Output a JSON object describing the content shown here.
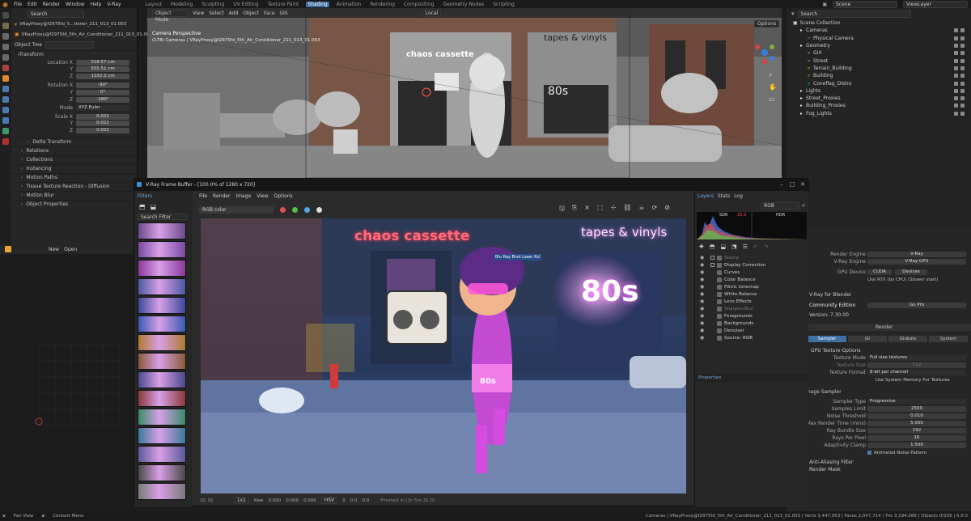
{
  "topbar": {
    "menus": [
      "File",
      "Edit",
      "Render",
      "Window",
      "Help",
      "V-Ray"
    ],
    "workspaces": [
      "Layout",
      "Modeling",
      "Sculpting",
      "UV Editing",
      "Texture Paint",
      "Shading",
      "Animation",
      "Rendering",
      "Compositing",
      "Geometry Nodes",
      "Scripting"
    ],
    "active_workspace": "Shading",
    "scene": "Scene",
    "view_layer": "ViewLayer",
    "search_placeholder": "Search"
  },
  "left_panel": {
    "breadcrumb1": "VRayProxy@f2975fd_5...tioner_211_013_01.003",
    "breadcrumb2": "VRayProxy@f2975fd_5th_Air_Conditioner_211_013_01.003",
    "object_tree_label": "Object Tree",
    "transform_header": "Transform",
    "location_label": "Location X",
    "location": [
      "218.57 cm",
      "555.51 cm",
      "1332.2 cm"
    ],
    "rotation_label": "Rotation X",
    "rotation": [
      "-90°",
      "0°",
      "-180°"
    ],
    "mode_label": "Mode",
    "mode_value": "XYZ Euler",
    "scale_label": "Scale X",
    "scale": [
      "0.022",
      "0.022",
      "0.022"
    ],
    "axis_y": "Y",
    "axis_z": "Z",
    "sections": [
      "Delta Transform",
      "Relations",
      "Collections",
      "Instancing",
      "Motion Paths",
      "Tissue Texture Reaction - Diffusion",
      "Motion Blur",
      "Object Properties"
    ],
    "new_label": "New",
    "open_label": "Open"
  },
  "viewport": {
    "mode": "Object Mode",
    "menus": [
      "View",
      "Select",
      "Add",
      "Object",
      "Face",
      "GIS"
    ],
    "transform_orientation": "Local",
    "camera_label": "Camera Perspective",
    "camera_path": "(178) Cameras | VRayProxy@f2975fd_5th_Air_Conditioner_211_013_01.003",
    "options": "Options",
    "signs": [
      "chaos cassette",
      "tapes & vinyls"
    ],
    "window_text": "80s"
  },
  "outliner": {
    "title": "Scene Collection",
    "items": [
      {
        "label": "Cameras",
        "indent": 1
      },
      {
        "label": "Physical Camera",
        "indent": 2
      },
      {
        "label": "Geometry",
        "indent": 1
      },
      {
        "label": "Girl",
        "indent": 2
      },
      {
        "label": "Street",
        "indent": 2
      },
      {
        "label": "Terrain_Building",
        "indent": 2
      },
      {
        "label": "Building",
        "indent": 2
      },
      {
        "label": "Coneflag_Distro",
        "indent": 2
      },
      {
        "label": "Lights",
        "indent": 1
      },
      {
        "label": "Street_Proxies",
        "indent": 1
      },
      {
        "label": "Building_Proxies",
        "indent": 1
      },
      {
        "label": "Fog_Lights",
        "indent": 1
      }
    ]
  },
  "render_props": {
    "engine_label": "Render Engine",
    "engine_value": "V-Ray",
    "vray_engine_label": "V-Ray Engine",
    "vray_engine_value": "V-Ray GPU",
    "gpu_device_label": "GPU Device",
    "cuda": "CUDA",
    "devices": "Devices",
    "rtx_note": "Use RTX (by CPU) (Slower start)",
    "vray_for_blender": "V-Ray for Blender",
    "community_edition": "Community Edition",
    "go_pro": "Go Pro",
    "version": "Version: 7.30.00",
    "render_label": "Render",
    "tabs": [
      "Sampler",
      "GI",
      "Globals",
      "System"
    ],
    "active_tab": "Sampler",
    "texture_options": "GPU Texture Options",
    "texture_mode_label": "Texture Mode",
    "texture_mode_value": "Full size textures",
    "texture_size_label": "Texture Size",
    "texture_size_value": "512",
    "texture_format_label": "Texture Format",
    "texture_format_value": "8-bit per channel",
    "system_memory": "Use System Memory For Textures",
    "image_sampler": "Image Sampler",
    "sampler_type_label": "Sampler Type",
    "sampler_type_value": "Progressive",
    "samples_limit_label": "Samples Limit",
    "samples_limit_value": "2500",
    "noise_threshold_label": "Noise Threshold",
    "noise_threshold_value": "0.010",
    "max_render_time_label": "Max Render Time (mins)",
    "max_render_time_value": "5.000",
    "ray_bundle_label": "Ray Bundle Size",
    "ray_bundle_value": "192",
    "rays_per_pixel_label": "Rays Per Pixel",
    "rays_per_pixel_value": "16",
    "adaptivity_label": "Adaptivity Clamp",
    "adaptivity_value": "1.500",
    "animated_noise": "Animated Noise Pattern",
    "anti_aliasing": "Anti-Aliasing Filter",
    "render_mask": "Render Mask"
  },
  "vfb": {
    "title": "V-Ray Frame Buffer - [100.0% of 1280 x 720]",
    "filters_tab": "Filters",
    "search_filter": "Search Filter",
    "menus": [
      "File",
      "Render",
      "Image",
      "View",
      "Options"
    ],
    "channel": "RGB color",
    "layer_tabs": [
      "Layers",
      "Stats",
      "Log"
    ],
    "active_layer_tab": "Layers",
    "layer_channel": "RGB",
    "sdr": "SDR",
    "hdr": "HDR",
    "sdr_value": "25.0",
    "layers": [
      {
        "label": "Stamp",
        "indent": 0,
        "dim": true
      },
      {
        "label": "Display Correction",
        "indent": 0,
        "dim": false
      },
      {
        "label": "Curves",
        "indent": 1,
        "dim": false
      },
      {
        "label": "Color Balance",
        "indent": 1,
        "dim": false
      },
      {
        "label": "Filmic tonemap",
        "indent": 1,
        "dim": false
      },
      {
        "label": "White Balance",
        "indent": 1,
        "dim": false
      },
      {
        "label": "Lens Effects",
        "indent": 1,
        "dim": false
      },
      {
        "label": "Sharpen/Blur",
        "indent": 1,
        "dim": true
      },
      {
        "label": "Foregrounds",
        "indent": 1,
        "dim": false
      },
      {
        "label": "Backgrounds",
        "indent": 1,
        "dim": false
      },
      {
        "label": "Denoiser",
        "indent": 1,
        "dim": false
      },
      {
        "label": "Source: RGB",
        "indent": 1,
        "dim": false
      }
    ],
    "properties": "Properties",
    "status": {
      "coords": "[0, 0]",
      "zoom": "1x1",
      "raw": "Raw",
      "v1": "0.000",
      "v2": "0.000",
      "v3": "0.000",
      "hsv": "HSV",
      "h": "0",
      "s": "0.0",
      "v": "0.0",
      "finished": "Finished in [1h 5m 31.0]"
    },
    "render_text": {
      "sign1": "chaos cassette",
      "sign2": "tapes & vinyls",
      "eighties": "80s",
      "shirt": "80s",
      "street_sign": "Blu Ray Blvd  Laser Rd"
    }
  },
  "statusbar": {
    "pan": "Pan View",
    "context": "Context Menu",
    "right": "Cameras | VRayProxy@f2975fd_5th_Air_Conditioner_211_013_01.003 | Verts 3,447,953 | Faces 2,047,714 | Tris 3,194,086 | Objects 0/205 | 5.0.0"
  },
  "colors": {
    "accent_blue": "#3f6fa5",
    "panel": "#262626",
    "pink": "#e93bd0",
    "neon_red": "#ff4a5a"
  }
}
